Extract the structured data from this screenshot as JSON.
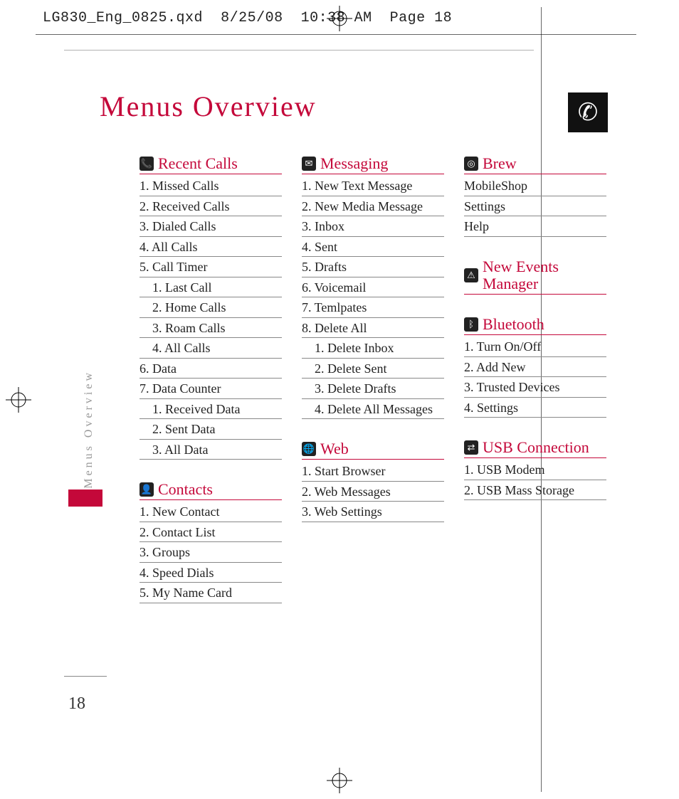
{
  "header": {
    "filename": "LG830_Eng_0825.qxd",
    "date": "8/25/08",
    "time": "10:38 AM",
    "page_label": "Page 18"
  },
  "title": "Menus Overview",
  "side_label": "Menus Overview",
  "page_number": "18",
  "phone_icon_glyph": "✆",
  "columns": [
    [
      {
        "icon": "📞",
        "title": "Recent Calls",
        "items": [
          {
            "t": "1. Missed Calls"
          },
          {
            "t": "2. Received Calls"
          },
          {
            "t": "3. Dialed Calls"
          },
          {
            "t": "4. All Calls"
          },
          {
            "t": "5. Call Timer"
          },
          {
            "t": "1. Last Call",
            "sub": true
          },
          {
            "t": "2. Home Calls",
            "sub": true
          },
          {
            "t": "3. Roam Calls",
            "sub": true
          },
          {
            "t": "4. All Calls",
            "sub": true
          },
          {
            "t": "6. Data"
          },
          {
            "t": "7.  Data Counter"
          },
          {
            "t": "1. Received Data",
            "sub": true
          },
          {
            "t": "2. Sent Data",
            "sub": true
          },
          {
            "t": "3. All Data",
            "sub": true
          }
        ]
      },
      {
        "icon": "👤",
        "title": "Contacts",
        "items": [
          {
            "t": "1. New Contact"
          },
          {
            "t": "2. Contact List"
          },
          {
            "t": "3. Groups"
          },
          {
            "t": "4. Speed Dials"
          },
          {
            "t": "5. My Name Card"
          }
        ]
      }
    ],
    [
      {
        "icon": "✉",
        "title": "Messaging",
        "items": [
          {
            "t": "1. New Text Message"
          },
          {
            "t": "2. New Media Message"
          },
          {
            "t": "3. Inbox"
          },
          {
            "t": "4. Sent"
          },
          {
            "t": "5. Drafts"
          },
          {
            "t": "6. Voicemail"
          },
          {
            "t": "7.  Temlpates"
          },
          {
            "t": "8. Delete All"
          },
          {
            "t": "1. Delete Inbox",
            "sub": true
          },
          {
            "t": "2. Delete Sent",
            "sub": true
          },
          {
            "t": "3. Delete Drafts",
            "sub": true
          },
          {
            "t": "4. Delete All Messages",
            "sub": true
          }
        ]
      },
      {
        "icon": "🌐",
        "title": "Web",
        "items": [
          {
            "t": "1. Start Browser"
          },
          {
            "t": "2. Web Messages"
          },
          {
            "t": "3. Web Settings"
          }
        ]
      }
    ],
    [
      {
        "icon": "◎",
        "title": "Brew",
        "items": [
          {
            "t": "MobileShop"
          },
          {
            "t": "Settings"
          },
          {
            "t": "Help"
          }
        ]
      },
      {
        "icon": "⚠",
        "title": "New Events Manager",
        "items": []
      },
      {
        "icon": "ᛒ",
        "title": "Bluetooth",
        "items": [
          {
            "t": "1.  Turn On/Off"
          },
          {
            "t": "2.  Add New"
          },
          {
            "t": "3.  Trusted Devices"
          },
          {
            "t": "4.  Settings"
          }
        ]
      },
      {
        "icon": "⇄",
        "title": "USB Connection",
        "items": [
          {
            "t": "1. USB Modem"
          },
          {
            "t": "2. USB Mass Storage"
          }
        ]
      }
    ]
  ]
}
